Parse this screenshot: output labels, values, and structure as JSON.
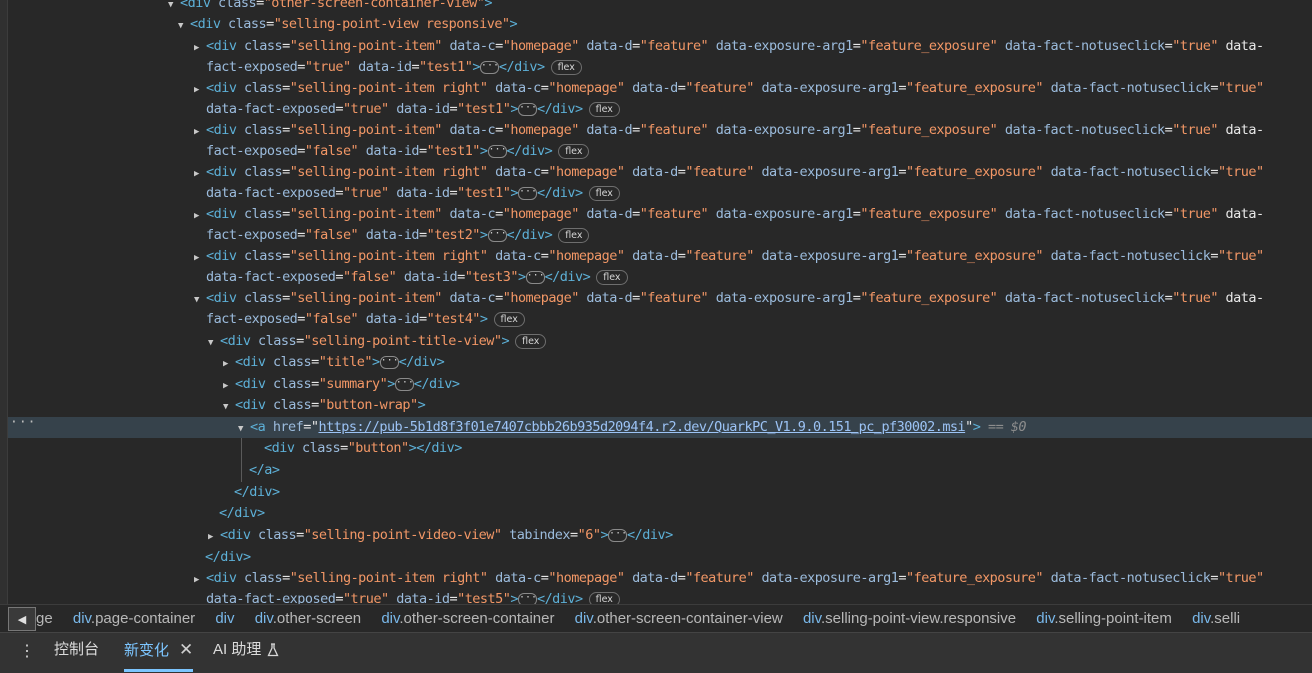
{
  "elements_tree": {
    "rows": [
      {
        "text": "<div class=\"other-screen-container-view\">"
      },
      {
        "text": "<div class=\"selling-point-view responsive\">"
      },
      {
        "text": "<div class=\"selling-point-item\" data-c=\"homepage\" data-d=\"feature\" data-exposure-arg1=\"feature_exposure\" data-fact-notuseclick=\"true\" data-"
      },
      {
        "text": "fact-exposed=\"true\" data-id=\"test1\">···</div>",
        "badge": "flex"
      },
      {
        "text": "<div class=\"selling-point-item right\" data-c=\"homepage\" data-d=\"feature\" data-exposure-arg1=\"feature_exposure\" data-fact-notuseclick=\"true\""
      },
      {
        "text": "data-fact-exposed=\"true\" data-id=\"test1\">···</div>",
        "badge": "flex"
      },
      {
        "text": "<div class=\"selling-point-item\" data-c=\"homepage\" data-d=\"feature\" data-exposure-arg1=\"feature_exposure\" data-fact-notuseclick=\"true\" data-"
      },
      {
        "text": "fact-exposed=\"false\" data-id=\"test1\">···</div>",
        "badge": "flex"
      },
      {
        "text": "<div class=\"selling-point-item right\" data-c=\"homepage\" data-d=\"feature\" data-exposure-arg1=\"feature_exposure\" data-fact-notuseclick=\"true\""
      },
      {
        "text": "data-fact-exposed=\"true\" data-id=\"test1\">···</div>",
        "badge": "flex"
      },
      {
        "text": "<div class=\"selling-point-item\" data-c=\"homepage\" data-d=\"feature\" data-exposure-arg1=\"feature_exposure\" data-fact-notuseclick=\"true\" data-"
      },
      {
        "text": "fact-exposed=\"false\" data-id=\"test2\">···</div>",
        "badge": "flex"
      },
      {
        "text": "<div class=\"selling-point-item right\" data-c=\"homepage\" data-d=\"feature\" data-exposure-arg1=\"feature_exposure\" data-fact-notuseclick=\"true\""
      },
      {
        "text": "data-fact-exposed=\"false\" data-id=\"test3\">···</div>",
        "badge": "flex"
      },
      {
        "text": "<div class=\"selling-point-item\" data-c=\"homepage\" data-d=\"feature\" data-exposure-arg1=\"feature_exposure\" data-fact-notuseclick=\"true\" data-"
      },
      {
        "text": "fact-exposed=\"false\" data-id=\"test4\">",
        "badge": "flex"
      },
      {
        "text": "<div class=\"selling-point-title-view\">",
        "badge": "flex"
      },
      {
        "text": "<div class=\"title\">···</div>"
      },
      {
        "text": "<div class=\"summary\">···</div>"
      },
      {
        "text": "<div class=\"button-wrap\">"
      },
      {
        "text": "<a href=\"https://pub-5b1d8f3f01e7407cbbb26b935d2094f4.r2.dev/QuarkPC_V1.9.0.151_pc_pf30002.msi\">",
        "ref": "== $0"
      },
      {
        "text": "<div class=\"button\"></div>"
      },
      {
        "text": "</a>"
      },
      {
        "text": "</div>"
      },
      {
        "text": "</div>"
      },
      {
        "text": "<div class=\"selling-point-video-view\" tabindex=\"6\">···</div>"
      },
      {
        "text": "</div>"
      },
      {
        "text": "<div class=\"selling-point-item right\" data-c=\"homepage\" data-d=\"feature\" data-exposure-arg1=\"feature_exposure\" data-fact-notuseclick=\"true\""
      },
      {
        "text": "data-fact-exposed=\"true\" data-id=\"test5\">···</div>",
        "badge": "flex"
      }
    ]
  },
  "breadcrumbs": [
    "ge",
    "div.page-container",
    "div",
    "div.other-screen",
    "div.other-screen-container",
    "div.other-screen-container-view",
    "div.selling-point-view.responsive",
    "div.selling-point-item",
    "div.selli"
  ],
  "drawer": {
    "tabs": [
      "控制台",
      "新变化",
      "AI 助理"
    ],
    "active_tab": "新变化"
  },
  "colors": {
    "background": "#282828",
    "tag": "#5db0d7",
    "attr_name": "#9bbbdc",
    "attr_value": "#f29766",
    "selected_row": "#36424b",
    "accent": "#7cc5ff"
  },
  "icons": [
    "expand-triangle-icon",
    "collapse-triangle-icon",
    "ellipsis-icon",
    "kebab-menu-icon",
    "close-icon",
    "flask-icon",
    "scroll-left-icon"
  ]
}
